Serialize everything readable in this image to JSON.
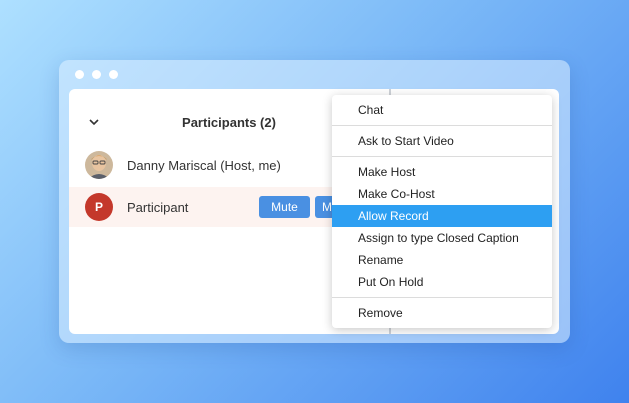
{
  "participants_panel": {
    "title": "Participants (2)",
    "rows": [
      {
        "name": "Danny Mariscal (Host, me)"
      },
      {
        "name": "Participant",
        "initial": "P",
        "mute_label": "Mute",
        "more_label": "M"
      }
    ]
  },
  "context_menu": {
    "items": [
      {
        "label": "Chat"
      },
      {
        "label": "Ask to Start Video"
      },
      {
        "label": "Make Host"
      },
      {
        "label": "Make Co-Host"
      },
      {
        "label": "Allow Record",
        "highlighted": true
      },
      {
        "label": "Assign to type Closed Caption"
      },
      {
        "label": "Rename"
      },
      {
        "label": "Put On Hold"
      },
      {
        "label": "Remove"
      }
    ]
  },
  "icons": {
    "collapse": "chevron-down-icon"
  },
  "colors": {
    "button_blue": "#4a90e2",
    "menu_highlight": "#2d9ff2",
    "participant_avatar": "#c4382b",
    "row_highlight": "#fdf3f0"
  }
}
